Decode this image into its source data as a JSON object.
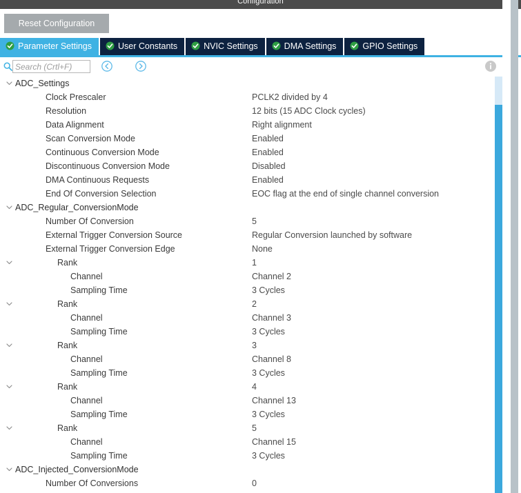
{
  "window": {
    "title": "Configuration"
  },
  "toolbar": {
    "reset_label": "Reset Configuration"
  },
  "tabs": [
    {
      "label": "Parameter Settings",
      "icon": "check-circle-icon",
      "active": true
    },
    {
      "label": "User Constants",
      "icon": "check-circle-icon",
      "active": false
    },
    {
      "label": "NVIC Settings",
      "icon": "check-circle-icon",
      "active": false
    },
    {
      "label": "DMA Settings",
      "icon": "check-circle-icon",
      "active": false
    },
    {
      "label": "GPIO Settings",
      "icon": "check-circle-icon",
      "active": false
    }
  ],
  "search": {
    "placeholder": "Search (Crtl+F)",
    "value": "",
    "icon": "search-icon",
    "prev_icon": "chevron-left-circle-icon",
    "next_icon": "chevron-right-circle-icon",
    "info_icon": "info-icon"
  },
  "colors": {
    "titlebar": "#4b4b4b",
    "tab_active": "#3fb2e3",
    "tab_inactive": "#0d2240",
    "accent": "#3fb2e3",
    "reset_button": "#a5aaad",
    "check_green": "#2e9e43",
    "scrollbar_inner": "#3ba8dd",
    "scrollbar_outer": "#b8c2c8"
  },
  "tree": {
    "rows": [
      {
        "label": "ADC_Settings",
        "value": "",
        "indent": 0,
        "group": true,
        "expanded": true
      },
      {
        "label": "Clock Prescaler",
        "value": "PCLK2 divided by 4",
        "indent": 1,
        "group": false,
        "expanded": null
      },
      {
        "label": "Resolution",
        "value": "12 bits (15 ADC Clock cycles)",
        "indent": 1,
        "group": false,
        "expanded": null
      },
      {
        "label": "Data Alignment",
        "value": "Right alignment",
        "indent": 1,
        "group": false,
        "expanded": null
      },
      {
        "label": "Scan Conversion Mode",
        "value": "Enabled",
        "indent": 1,
        "group": false,
        "expanded": null
      },
      {
        "label": "Continuous Conversion Mode",
        "value": "Enabled",
        "indent": 1,
        "group": false,
        "expanded": null
      },
      {
        "label": "Discontinuous Conversion Mode",
        "value": "Disabled",
        "indent": 1,
        "group": false,
        "expanded": null
      },
      {
        "label": "DMA Continuous Requests",
        "value": "Enabled",
        "indent": 1,
        "group": false,
        "expanded": null
      },
      {
        "label": "End Of Conversion Selection",
        "value": "EOC flag at the end of single channel conversion",
        "indent": 1,
        "group": false,
        "expanded": null
      },
      {
        "label": "ADC_Regular_ConversionMode",
        "value": "",
        "indent": 0,
        "group": true,
        "expanded": true
      },
      {
        "label": "Number Of Conversion",
        "value": "5",
        "indent": 1,
        "group": false,
        "expanded": null
      },
      {
        "label": "External Trigger Conversion Source",
        "value": "Regular Conversion launched by software",
        "indent": 1,
        "group": false,
        "expanded": null
      },
      {
        "label": "External Trigger Conversion Edge",
        "value": "None",
        "indent": 1,
        "group": false,
        "expanded": null
      },
      {
        "label": "Rank",
        "value": "1",
        "indent": 2,
        "group": false,
        "expanded": true
      },
      {
        "label": "Channel",
        "value": "Channel 2",
        "indent": 3,
        "group": false,
        "expanded": null
      },
      {
        "label": "Sampling Time",
        "value": "3 Cycles",
        "indent": 3,
        "group": false,
        "expanded": null
      },
      {
        "label": "Rank",
        "value": "2",
        "indent": 2,
        "group": false,
        "expanded": true
      },
      {
        "label": "Channel",
        "value": "Channel 3",
        "indent": 3,
        "group": false,
        "expanded": null
      },
      {
        "label": "Sampling Time",
        "value": "3 Cycles",
        "indent": 3,
        "group": false,
        "expanded": null
      },
      {
        "label": "Rank",
        "value": "3",
        "indent": 2,
        "group": false,
        "expanded": true
      },
      {
        "label": "Channel",
        "value": "Channel 8",
        "indent": 3,
        "group": false,
        "expanded": null
      },
      {
        "label": "Sampling Time",
        "value": "3 Cycles",
        "indent": 3,
        "group": false,
        "expanded": null
      },
      {
        "label": "Rank",
        "value": "4",
        "indent": 2,
        "group": false,
        "expanded": true
      },
      {
        "label": "Channel",
        "value": "Channel 13",
        "indent": 3,
        "group": false,
        "expanded": null
      },
      {
        "label": "Sampling Time",
        "value": "3 Cycles",
        "indent": 3,
        "group": false,
        "expanded": null
      },
      {
        "label": "Rank",
        "value": "5",
        "indent": 2,
        "group": false,
        "expanded": true
      },
      {
        "label": "Channel",
        "value": "Channel 15",
        "indent": 3,
        "group": false,
        "expanded": null
      },
      {
        "label": "Sampling Time",
        "value": "3 Cycles",
        "indent": 3,
        "group": false,
        "expanded": null
      },
      {
        "label": "ADC_Injected_ConversionMode",
        "value": "",
        "indent": 0,
        "group": true,
        "expanded": true
      },
      {
        "label": "Number Of Conversions",
        "value": "0",
        "indent": 1,
        "group": false,
        "expanded": null
      }
    ]
  }
}
